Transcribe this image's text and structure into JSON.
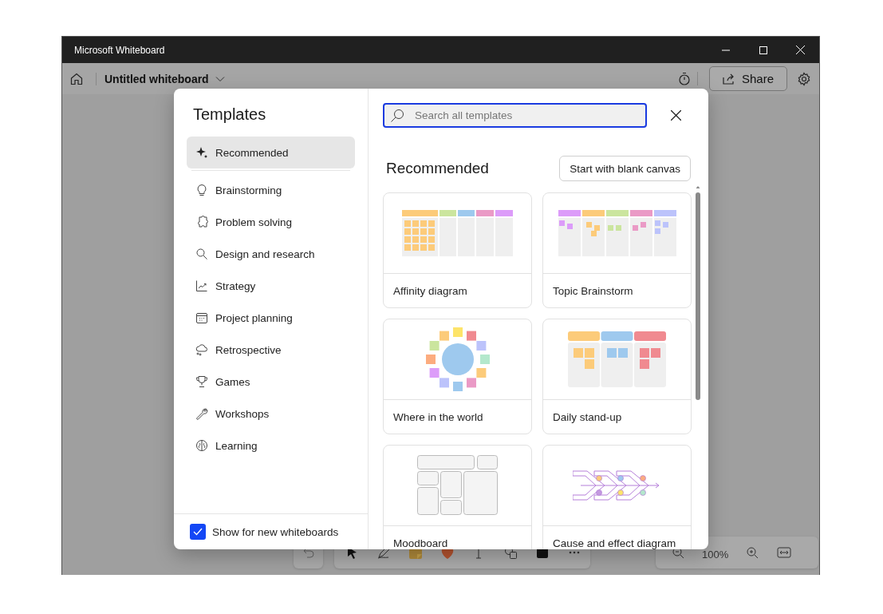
{
  "window": {
    "title": "Microsoft Whiteboard"
  },
  "toolbar": {
    "board_title": "Untitled whiteboard",
    "share_label": "Share"
  },
  "templates": {
    "title": "Templates",
    "categories": [
      {
        "label": "Recommended",
        "selected": true
      },
      {
        "label": "Brainstorming",
        "selected": false
      },
      {
        "label": "Problem solving",
        "selected": false
      },
      {
        "label": "Design and research",
        "selected": false
      },
      {
        "label": "Strategy",
        "selected": false
      },
      {
        "label": "Project planning",
        "selected": false
      },
      {
        "label": "Retrospective",
        "selected": false
      },
      {
        "label": "Games",
        "selected": false
      },
      {
        "label": "Workshops",
        "selected": false
      },
      {
        "label": "Learning",
        "selected": false
      }
    ],
    "show_for_new": {
      "label": "Show for new whiteboards",
      "checked": true
    },
    "search": {
      "placeholder": "Search all templates"
    },
    "section_title": "Recommended",
    "blank_button": "Start with blank canvas",
    "cards": [
      {
        "title": "Affinity diagram",
        "kind": "affinity"
      },
      {
        "title": "Topic Brainstorm",
        "kind": "topics"
      },
      {
        "title": "Where in the world",
        "kind": "ring"
      },
      {
        "title": "Daily stand-up",
        "kind": "standup"
      },
      {
        "title": "Moodboard",
        "kind": "moodboard"
      },
      {
        "title": "Cause and effect diagram",
        "kind": "fishbone"
      }
    ]
  },
  "bottom_toolbar": {
    "zoom_text": "100%"
  }
}
